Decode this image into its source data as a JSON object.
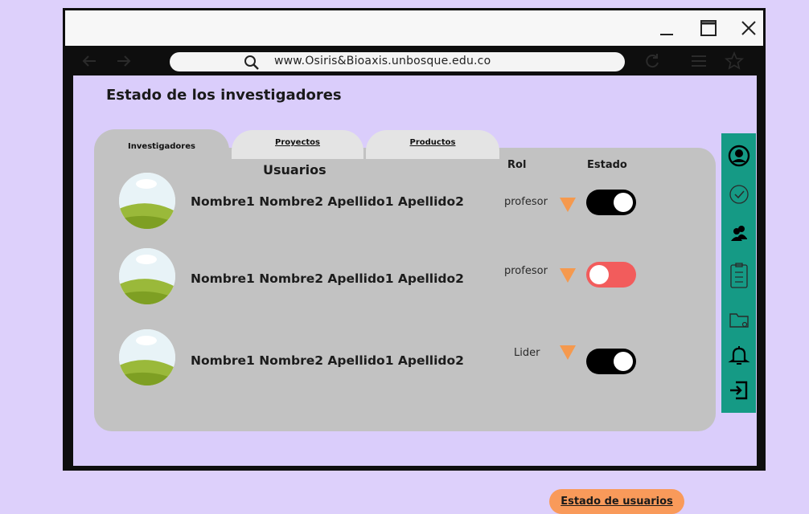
{
  "browser": {
    "url": "www.Osiris&Bioaxis.unbosque.edu.co",
    "title_controls": [
      "minimize-icon",
      "maximize-icon",
      "close-icon"
    ],
    "nav_icons": [
      "back-arrow-icon",
      "forward-arrow-icon",
      "reload-icon",
      "menu-icon",
      "star-icon"
    ]
  },
  "page": {
    "title": "Estado de los investigadores"
  },
  "tabs": [
    {
      "label": "Investigadores",
      "active": true
    },
    {
      "label": "Proyectos",
      "active": false
    },
    {
      "label": "Productos",
      "active": false
    }
  ],
  "table": {
    "headers": {
      "users": "Usuarios",
      "role": "Rol",
      "status": "Estado"
    },
    "rows": [
      {
        "name": "Nombre1 Nombre2 Apellido1 Apellido2",
        "role": "profesor",
        "active": true,
        "toggle_color": "#000000"
      },
      {
        "name": "Nombre1 Nombre2 Apellido1 Apellido2",
        "role": "profesor",
        "active": false,
        "toggle_color": "#f25c5c"
      },
      {
        "name": "Nombre1 Nombre2 Apellido1 Apellido2",
        "role": "Lider",
        "active": true,
        "toggle_color": "#000000"
      }
    ]
  },
  "actions": {
    "status_button": "Estado de usuarios"
  },
  "sidebar": {
    "icons": [
      "user-icon",
      "check-circle-icon",
      "group-icon",
      "clipboard-icon",
      "folder-icon",
      "bell-icon",
      "logout-icon"
    ]
  },
  "colors": {
    "background": "#ddd0fb",
    "panel": "#c2c2c2",
    "sidebar": "#159a85",
    "accent_orange": "#f99a5a",
    "dropdown_triangle": "#f5994e"
  }
}
